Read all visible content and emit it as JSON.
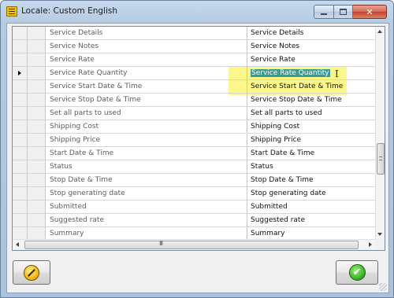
{
  "window": {
    "title": "Locale: Custom English",
    "icons": {
      "app": "app-window-icon",
      "minimize": "minimize-icon",
      "maximize": "maximize-icon",
      "close": "close-icon"
    },
    "close_glyph": "✕"
  },
  "grid": {
    "current_row_index": 3,
    "selected_value": "Service Rate Quantity",
    "rows": [
      {
        "key": "Service Details",
        "value": "Service Details"
      },
      {
        "key": "Service Notes",
        "value": "Service Notes"
      },
      {
        "key": "Service Rate",
        "value": "Service Rate"
      },
      {
        "key": "Service Rate Quantity",
        "value": "Service Rate Quantity"
      },
      {
        "key": "Service Start Date & Time",
        "value": "Service Start Date & Time"
      },
      {
        "key": "Service Stop Date & Time",
        "value": "Service Stop Date & Time"
      },
      {
        "key": "Set all parts to used",
        "value": "Set all parts to used"
      },
      {
        "key": "Shipping Cost",
        "value": "Shipping Cost"
      },
      {
        "key": "Shipping Price",
        "value": "Shipping Price"
      },
      {
        "key": "Start Date & Time",
        "value": "Start Date & Time"
      },
      {
        "key": "Status",
        "value": "Status"
      },
      {
        "key": "Stop Date & Time",
        "value": "Stop Date & Time"
      },
      {
        "key": "Stop generating date",
        "value": "Stop generating date"
      },
      {
        "key": "Submitted",
        "value": "Submitted"
      },
      {
        "key": "Suggested rate",
        "value": "Suggested rate"
      },
      {
        "key": "Summary",
        "value": "Summary"
      }
    ],
    "hscroll_grip": "III",
    "highlight_color": "#fbf67e",
    "selection_color": "#3b9b8f"
  },
  "buttons": {
    "cancel": {
      "icon": "cancel-circle-icon"
    },
    "ok": {
      "icon": "ok-checkmark-icon",
      "glyph": "✔"
    }
  }
}
